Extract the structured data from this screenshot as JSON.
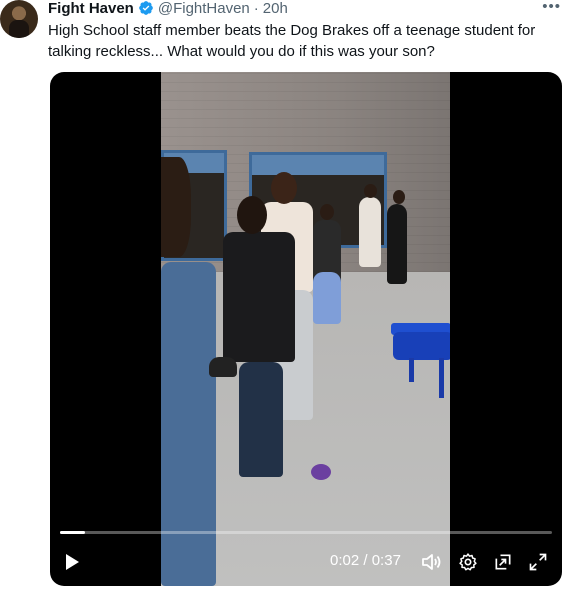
{
  "post": {
    "author_name": "Fight Haven",
    "author_handle": "@FightHaven",
    "separator": "·",
    "timestamp": "20h",
    "more_label": "•••",
    "text": "High School staff member beats the Dog Brakes off a teenage student for talking reckless... What would you do if this was your son?",
    "verified": true
  },
  "player": {
    "current_time": "0:02",
    "time_separator": " / ",
    "duration": "0:37",
    "progress_fraction": 0.05
  },
  "colors": {
    "verified_badge": "#1d9bf0",
    "secondary_text": "#536471",
    "primary_text": "#0f1419",
    "media_background": "#000000"
  },
  "icons": {
    "verified": "verified-badge-icon",
    "more": "more-options-icon",
    "play": "play-icon",
    "volume": "volume-icon",
    "settings": "settings-gear-icon",
    "pip": "picture-in-picture-icon",
    "fullscreen": "fullscreen-icon"
  }
}
